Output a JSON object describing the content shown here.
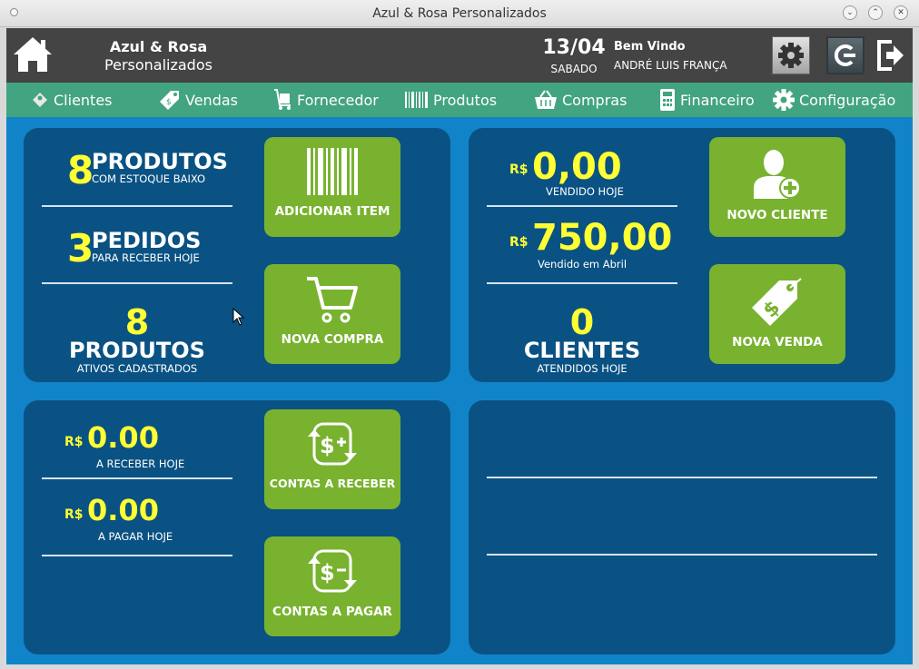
{
  "window": {
    "title": "Azul & Rosa Personalizados"
  },
  "header": {
    "brand_line1": "Azul & Rosa",
    "brand_line2": "Personalizados",
    "date": "13/04",
    "weekday": "SABADO",
    "welcome": "Bem Vindo",
    "user": "ANDRÉ LUIS FRANÇA"
  },
  "nav": [
    "Clientes",
    "Vendas",
    "Fornecedor",
    "Produtos",
    "Compras",
    "Financeiro",
    "Configuração"
  ],
  "stock": {
    "low_count": "8",
    "low_title": "PRODUTOS",
    "low_sub": "COM ESTOQUE BAIXO",
    "orders_count": "3",
    "orders_title": "PEDIDOS",
    "orders_sub": "PARA RECEBER HOJE",
    "active_count": "8",
    "active_title": "PRODUTOS",
    "active_sub": "ATIVOS CADASTRADOS",
    "btn_add": "ADICIONAR ITEM",
    "btn_buy": "NOVA COMPRA"
  },
  "sales": {
    "currency": "R$",
    "today_value": "0,00",
    "today_label": "VENDIDO HOJE",
    "month_value": "750,00",
    "month_label": "Vendido em Abril",
    "clients_count": "0",
    "clients_title": "CLIENTES",
    "clients_sub": "ATENDIDOS HOJE",
    "btn_client": "NOVO CLIENTE",
    "btn_sale": "NOVA VENDA"
  },
  "finance": {
    "currency": "R$",
    "receive_value": "0.00",
    "receive_label": "A RECEBER HOJE",
    "pay_value": "0.00",
    "pay_label": "A PAGAR HOJE",
    "btn_receive": "CONTAS A RECEBER",
    "btn_pay": "CONTAS A PAGAR"
  },
  "colors": {
    "header": "#444444",
    "nav": "#42a480",
    "main": "#1184c9",
    "panel": "#0a5283",
    "button": "#78b22f",
    "accent": "#ffff33"
  }
}
